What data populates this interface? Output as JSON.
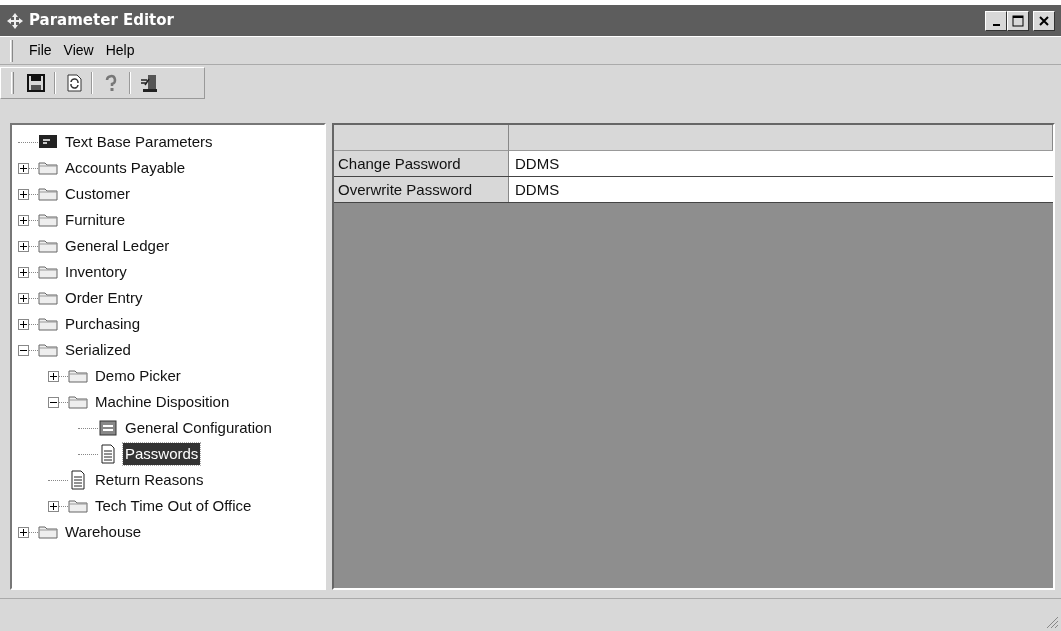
{
  "window": {
    "title": "Parameter Editor"
  },
  "menu": [
    {
      "label": "File"
    },
    {
      "label": "View"
    },
    {
      "label": "Help"
    }
  ],
  "toolbar": [
    {
      "kind": "save"
    },
    {
      "kind": "refresh"
    },
    {
      "kind": "help"
    },
    {
      "kind": "exit"
    }
  ],
  "tree": [
    {
      "label": "Text Base Parameters",
      "kind": "textbase",
      "selected": false
    },
    {
      "label": "Accounts Payable",
      "kind": "folder",
      "expanded": false,
      "selected": false
    },
    {
      "label": "Customer",
      "kind": "folder",
      "expanded": false,
      "selected": false
    },
    {
      "label": "Furniture",
      "kind": "folder",
      "expanded": false,
      "selected": false
    },
    {
      "label": "General Ledger",
      "kind": "folder",
      "expanded": false,
      "selected": false
    },
    {
      "label": "Inventory",
      "kind": "folder",
      "expanded": false,
      "selected": false
    },
    {
      "label": "Order Entry",
      "kind": "folder",
      "expanded": false,
      "selected": false
    },
    {
      "label": "Purchasing",
      "kind": "folder",
      "expanded": false,
      "selected": false
    },
    {
      "label": "Serialized",
      "kind": "folder",
      "expanded": true,
      "selected": false,
      "children": [
        {
          "label": "Demo Picker",
          "kind": "folder",
          "expanded": false,
          "selected": false
        },
        {
          "label": "Machine Disposition",
          "kind": "folder",
          "expanded": true,
          "selected": false,
          "children": [
            {
              "label": "General Configuration",
              "kind": "config",
              "selected": false
            },
            {
              "label": "Passwords",
              "kind": "document",
              "selected": true
            }
          ]
        },
        {
          "label": "Return Reasons",
          "kind": "document",
          "selected": false
        },
        {
          "label": "Tech Time Out of Office",
          "kind": "folder",
          "expanded": false,
          "selected": false
        }
      ]
    },
    {
      "label": "Warehouse",
      "kind": "folder",
      "expanded": false,
      "selected": false
    }
  ],
  "grid": {
    "rows": [
      {
        "name": "Change Password",
        "value": "DDMS"
      },
      {
        "name": "Overwrite Password",
        "value": "DDMS"
      }
    ]
  }
}
